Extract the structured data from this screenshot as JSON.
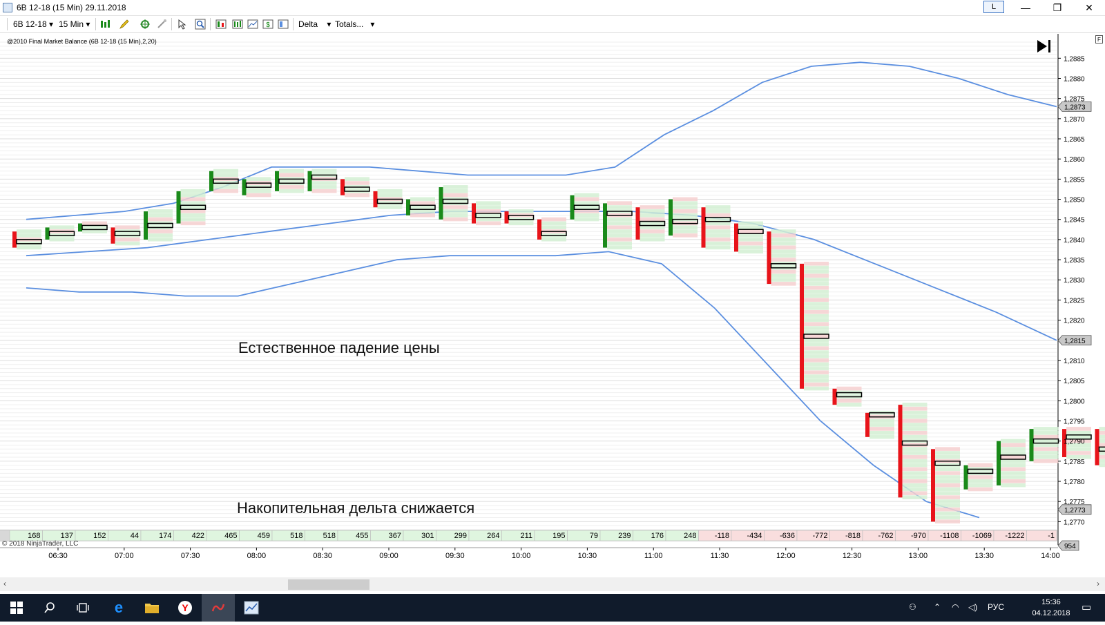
{
  "window": {
    "title": "6B 12-18 (15 Min)  29.11.2018",
    "link_button": "L",
    "controls": {
      "minimize": "—",
      "restore": "❐",
      "close": "✕"
    }
  },
  "toolbar": {
    "instrument": "6B 12-18",
    "interval": "15 Min",
    "column_type": "Delta",
    "totals": "Totals..."
  },
  "indicator_label": "@2010 Final Market Balance  (6B 12-18 (15 Min),2,20)",
  "play_icon": "skip-to-end-icon",
  "copyright": "© 2018 NinjaTrader, LLC",
  "annotations": {
    "top": "Естественное падение цены",
    "bottom": "Накопительная дельта снижается"
  },
  "price_axis": {
    "labels": [
      "1,2885",
      "1,2880",
      "1,2875",
      "1,2870",
      "1,2865",
      "1,2860",
      "1,2855",
      "1,2850",
      "1,2845",
      "1,2840",
      "1,2835",
      "1,2830",
      "1,2825",
      "1,2820",
      "1,2815",
      "1,2810",
      "1,2805",
      "1,2800",
      "1,2795",
      "1,2790",
      "1,2785",
      "1,2780",
      "1,2775",
      "1,2770"
    ],
    "markers": [
      {
        "label": "1,2873",
        "price": 1.2873,
        "bg": "#c8c8c8"
      },
      {
        "label": "1,2815",
        "price": 1.2815,
        "bg": "#c8c8c8"
      },
      {
        "label": "1,2773",
        "price": 1.2773,
        "bg": "#c8c8c8"
      }
    ],
    "extra_marker": "954"
  },
  "time_axis": {
    "labels": [
      "06:30",
      "07:00",
      "07:30",
      "08:00",
      "08:30",
      "09:00",
      "09:30",
      "10:00",
      "10:30",
      "11:00",
      "11:30",
      "12:00",
      "12:30",
      "13:00",
      "13:30",
      "14:00"
    ]
  },
  "chart_data": {
    "type": "candlestick",
    "series": [
      {
        "name": "bars",
        "ohlc": [
          [
            1.284,
            1.2842,
            1.2838,
            1.2839
          ],
          [
            1.2841,
            1.2843,
            1.284,
            1.2842
          ],
          [
            1.2843,
            1.2844,
            1.2842,
            1.2843
          ],
          [
            1.2842,
            1.2843,
            1.2839,
            1.2841
          ],
          [
            1.2841,
            1.2847,
            1.284,
            1.2846
          ],
          [
            1.2845,
            1.2852,
            1.2844,
            1.2851
          ],
          [
            1.2853,
            1.2857,
            1.2852,
            1.2856
          ],
          [
            1.2853,
            1.2855,
            1.2851,
            1.2854
          ],
          [
            1.2853,
            1.2857,
            1.2852,
            1.2856
          ],
          [
            1.2855,
            1.2857,
            1.2852,
            1.2856
          ],
          [
            1.2854,
            1.2855,
            1.2851,
            1.2851
          ],
          [
            1.2851,
            1.2852,
            1.2848,
            1.2848
          ],
          [
            1.2847,
            1.285,
            1.2846,
            1.2849
          ],
          [
            1.2849,
            1.2853,
            1.2845,
            1.285
          ],
          [
            1.2847,
            1.2849,
            1.2844,
            1.2845
          ],
          [
            1.2846,
            1.2847,
            1.2844,
            1.2845
          ],
          [
            1.2842,
            1.2845,
            1.284,
            1.2841
          ],
          [
            1.2848,
            1.2851,
            1.2845,
            1.2848
          ],
          [
            1.2846,
            1.2849,
            1.2838,
            1.2847
          ],
          [
            1.2845,
            1.2848,
            1.284,
            1.2843
          ],
          [
            1.2843,
            1.285,
            1.2841,
            1.2846
          ],
          [
            1.2846,
            1.2848,
            1.2838,
            1.2844
          ],
          [
            1.2843,
            1.2844,
            1.2837,
            1.2841
          ],
          [
            1.284,
            1.2842,
            1.2829,
            1.2827
          ],
          [
            1.2829,
            1.2834,
            1.2803,
            1.2803
          ],
          [
            1.2804,
            1.2803,
            1.2799,
            1.2799
          ],
          [
            1.2799,
            1.2797,
            1.2791,
            1.2794
          ],
          [
            1.2799,
            1.2799,
            1.2776,
            1.278
          ],
          [
            1.2785,
            1.2788,
            1.277,
            1.2784
          ],
          [
            1.2781,
            1.2784,
            1.2778,
            1.2784
          ],
          [
            1.2783,
            1.279,
            1.2779,
            1.2789
          ],
          [
            1.2788,
            1.2793,
            1.2785,
            1.2792
          ],
          [
            1.2792,
            1.2793,
            1.2786,
            1.279
          ],
          [
            1.279,
            1.2793,
            1.2784,
            1.2786
          ],
          [
            1.2786,
            1.2789,
            1.278,
            1.2782
          ],
          [
            1.2782,
            1.2784,
            1.2772,
            1.2774
          ]
        ]
      },
      {
        "name": "upper band",
        "values": [
          1.2845,
          1.2846,
          1.2847,
          1.2849,
          1.2853,
          1.2858,
          1.2858,
          1.2858,
          1.2857,
          1.2856,
          1.2856,
          1.2856,
          1.2858,
          1.2866,
          1.2872,
          1.2879,
          1.2883,
          1.2884,
          1.2883,
          1.288,
          1.2876,
          1.2873
        ]
      },
      {
        "name": "middle band",
        "values": [
          1.2836,
          1.2837,
          1.2838,
          1.284,
          1.2842,
          1.2844,
          1.2846,
          1.2847,
          1.2847,
          1.2847,
          1.2847,
          1.2846,
          1.2844,
          1.284,
          1.2834,
          1.2828,
          1.2822,
          1.2815
        ]
      },
      {
        "name": "lower band",
        "values": [
          1.2828,
          1.2827,
          1.2827,
          1.2826,
          1.2826,
          1.2829,
          1.2832,
          1.2835,
          1.2836,
          1.2836,
          1.2836,
          1.2837,
          1.2834,
          1.2823,
          1.2809,
          1.2795,
          1.2784,
          1.2775,
          1.2771
        ]
      }
    ],
    "delta_row": [
      168,
      137,
      152,
      44,
      174,
      422,
      465,
      459,
      518,
      518,
      455,
      367,
      301,
      299,
      264,
      211,
      195,
      79,
      239,
      176,
      248,
      -118,
      -434,
      -636,
      -772,
      -818,
      -762,
      -970,
      -1108,
      -1069,
      -1222,
      -1
    ],
    "ylim": [
      1.2768,
      1.2889
    ],
    "colors": {
      "up": "#1a8a1a",
      "down": "#e8141a",
      "band": "#5b8fe0",
      "vol_up": "#d4f0d4",
      "vol_down": "#f6d0d0",
      "delta_pos": "#dff5df",
      "delta_neg": "#f9dede"
    }
  },
  "taskbar": {
    "language": "РУС",
    "time": "15:36",
    "date": "04.12.2018"
  }
}
